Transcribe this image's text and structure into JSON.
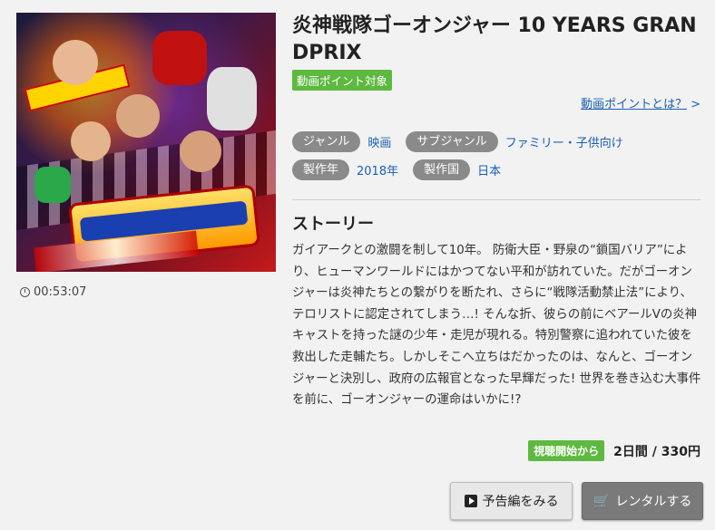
{
  "item": {
    "title": "炎神戦隊ゴーオンジャー 10 YEARS GRANDPRIX",
    "point_badge": "動画ポイント対象",
    "point_link": "動画ポイントとは？",
    "point_link_arrow": ">",
    "duration": "00:53:07"
  },
  "meta": {
    "genre_label": "ジャンル",
    "genre_value": "映画",
    "subgenre_label": "サブジャンル",
    "subgenre_value": "ファミリー・子供向け",
    "year_label": "製作年",
    "year_value": "2018年",
    "country_label": "製作国",
    "country_value": "日本"
  },
  "story": {
    "heading": "ストーリー",
    "text": "ガイアークとの激闘を制して10年。 防衛大臣・野泉の“鎖国バリア”により、ヒューマンワールドにはかつてない平和が訪れていた。だがゴーオンジャーは炎神たちとの繋がりを断たれ、さらに“戦隊活動禁止法”により、テロリストに認定されてしまう…! そんな折、彼らの前にベアールVの炎神キャストを持った謎の少年・走児が現れる。特別警察に追われていた彼を救出した走輔たち。しかしそこへ立ちはだかったのは、なんと、ゴーオンジャーと決別し、政府の広報官となった早輝だった! 世界を巻き込む大事件を前に、ゴーオンジャーの運命はいかに!?"
  },
  "purchase": {
    "start_badge": "視聴開始から",
    "price": "2日間 / 330円",
    "preview_button": "予告編をみる",
    "rental_button": "レンタルする"
  },
  "colors": {
    "accent_green": "#5db93f",
    "link_blue": "#1a5fb4",
    "tag_gray": "#8a8a8a"
  },
  "icons": {
    "clock": "clock-icon",
    "play": "play-icon",
    "cart": "cart-icon"
  }
}
